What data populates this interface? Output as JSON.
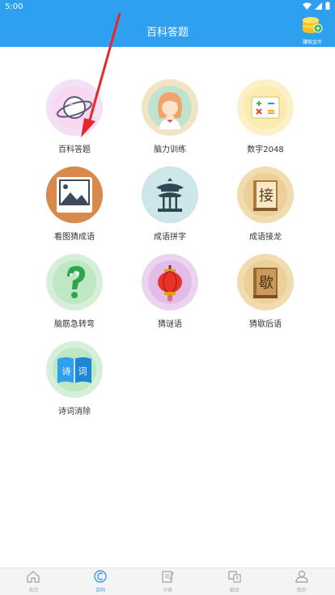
{
  "status": {
    "time": "5:00"
  },
  "header": {
    "title": "百科答题",
    "coin_label": "赚取金币"
  },
  "items": [
    {
      "label": "百科答题",
      "icon": "saturn-planet-icon"
    },
    {
      "label": "脑力训练",
      "icon": "girl-avatar-icon"
    },
    {
      "label": "数字2048",
      "icon": "math-symbols-icon"
    },
    {
      "label": "看图猜成语",
      "icon": "picture-frame-icon"
    },
    {
      "label": "成语拼字",
      "icon": "pavilion-icon"
    },
    {
      "label": "成语接龙",
      "icon": "book-jie-icon"
    },
    {
      "label": "脑筋急转弯",
      "icon": "question-mark-icon"
    },
    {
      "label": "猜谜语",
      "icon": "lantern-icon"
    },
    {
      "label": "猜歇后语",
      "icon": "book-xie-icon"
    },
    {
      "label": "诗词消除",
      "icon": "poetry-book-icon"
    }
  ],
  "book_jie_char": "接",
  "book_xie_char": "歇",
  "poetry_chars": [
    "诗",
    "词"
  ],
  "tabs": [
    {
      "label": "首页",
      "icon": "home-icon"
    },
    {
      "label": "百科",
      "icon": "encyclopedia-icon",
      "active": true
    },
    {
      "label": "字典",
      "icon": "dictionary-icon"
    },
    {
      "label": "翻译",
      "icon": "translate-icon"
    },
    {
      "label": "我的",
      "icon": "profile-icon"
    }
  ],
  "colors": {
    "accent": "#2f9ff0",
    "arrow": "#e8262a"
  }
}
